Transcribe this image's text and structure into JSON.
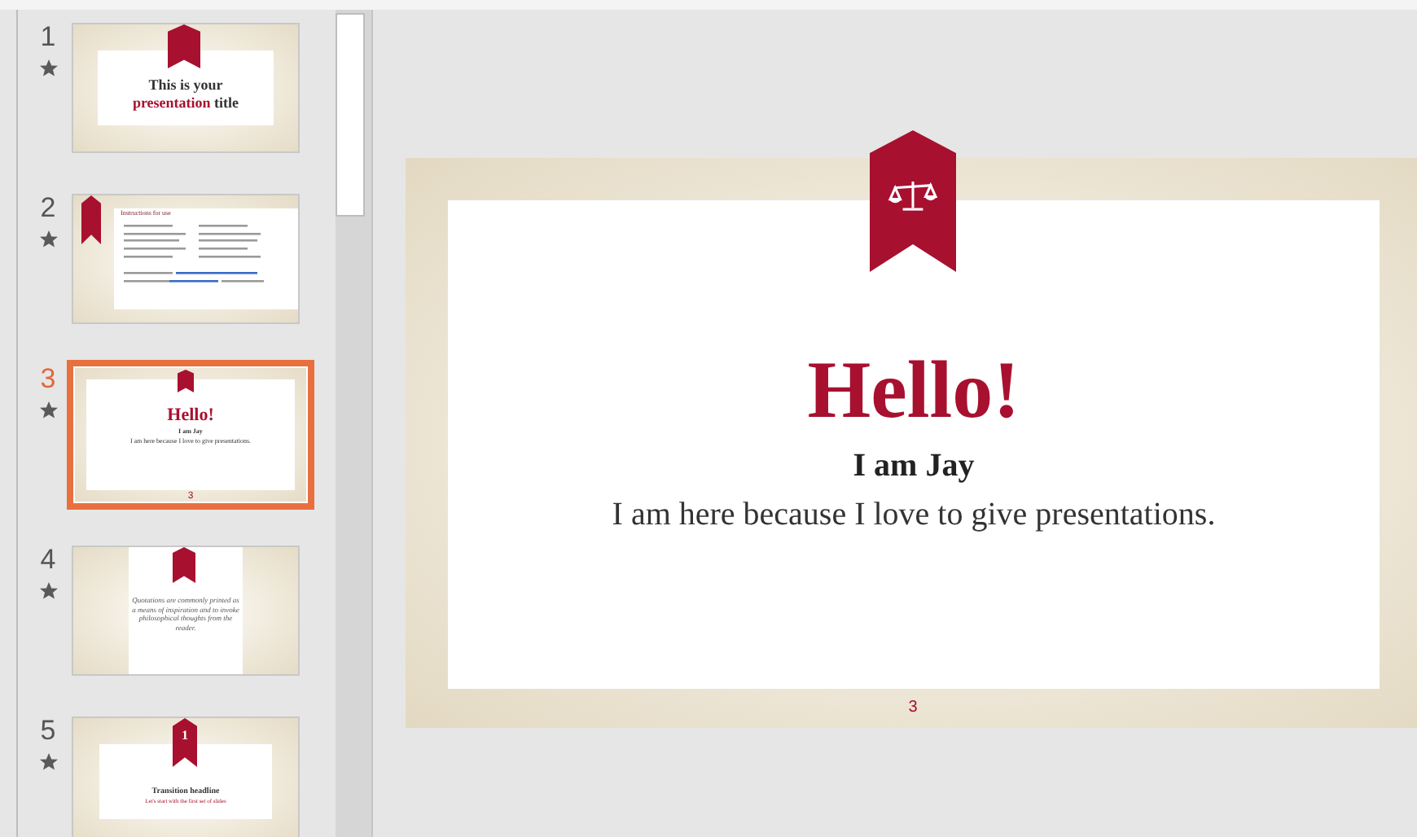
{
  "slides": [
    {
      "number": "1",
      "kind": "title",
      "selected": false,
      "lines": [
        "This is your",
        "**presentation** title"
      ]
    },
    {
      "number": "2",
      "kind": "instructions",
      "selected": false,
      "lines": [
        "Instructions for use"
      ]
    },
    {
      "number": "3",
      "kind": "hello",
      "selected": true,
      "lines": [
        "Hello!",
        "I am Jay",
        "I am here because I love to give presentations."
      ],
      "page": "3"
    },
    {
      "number": "4",
      "kind": "quote",
      "selected": false,
      "lines": [
        "Quotations are commonly printed as a means of *inspiration* and to invoke philosophical thoughts from the reader."
      ]
    },
    {
      "number": "5",
      "kind": "transition",
      "selected": false,
      "badge": "1",
      "lines": [
        "Transition headline",
        "Let's start with the first set of slides"
      ]
    }
  ],
  "editor": {
    "title": "Hello!",
    "name": "I am Jay",
    "subtitle": "I am here because I love to give presentations.",
    "page": "3"
  }
}
